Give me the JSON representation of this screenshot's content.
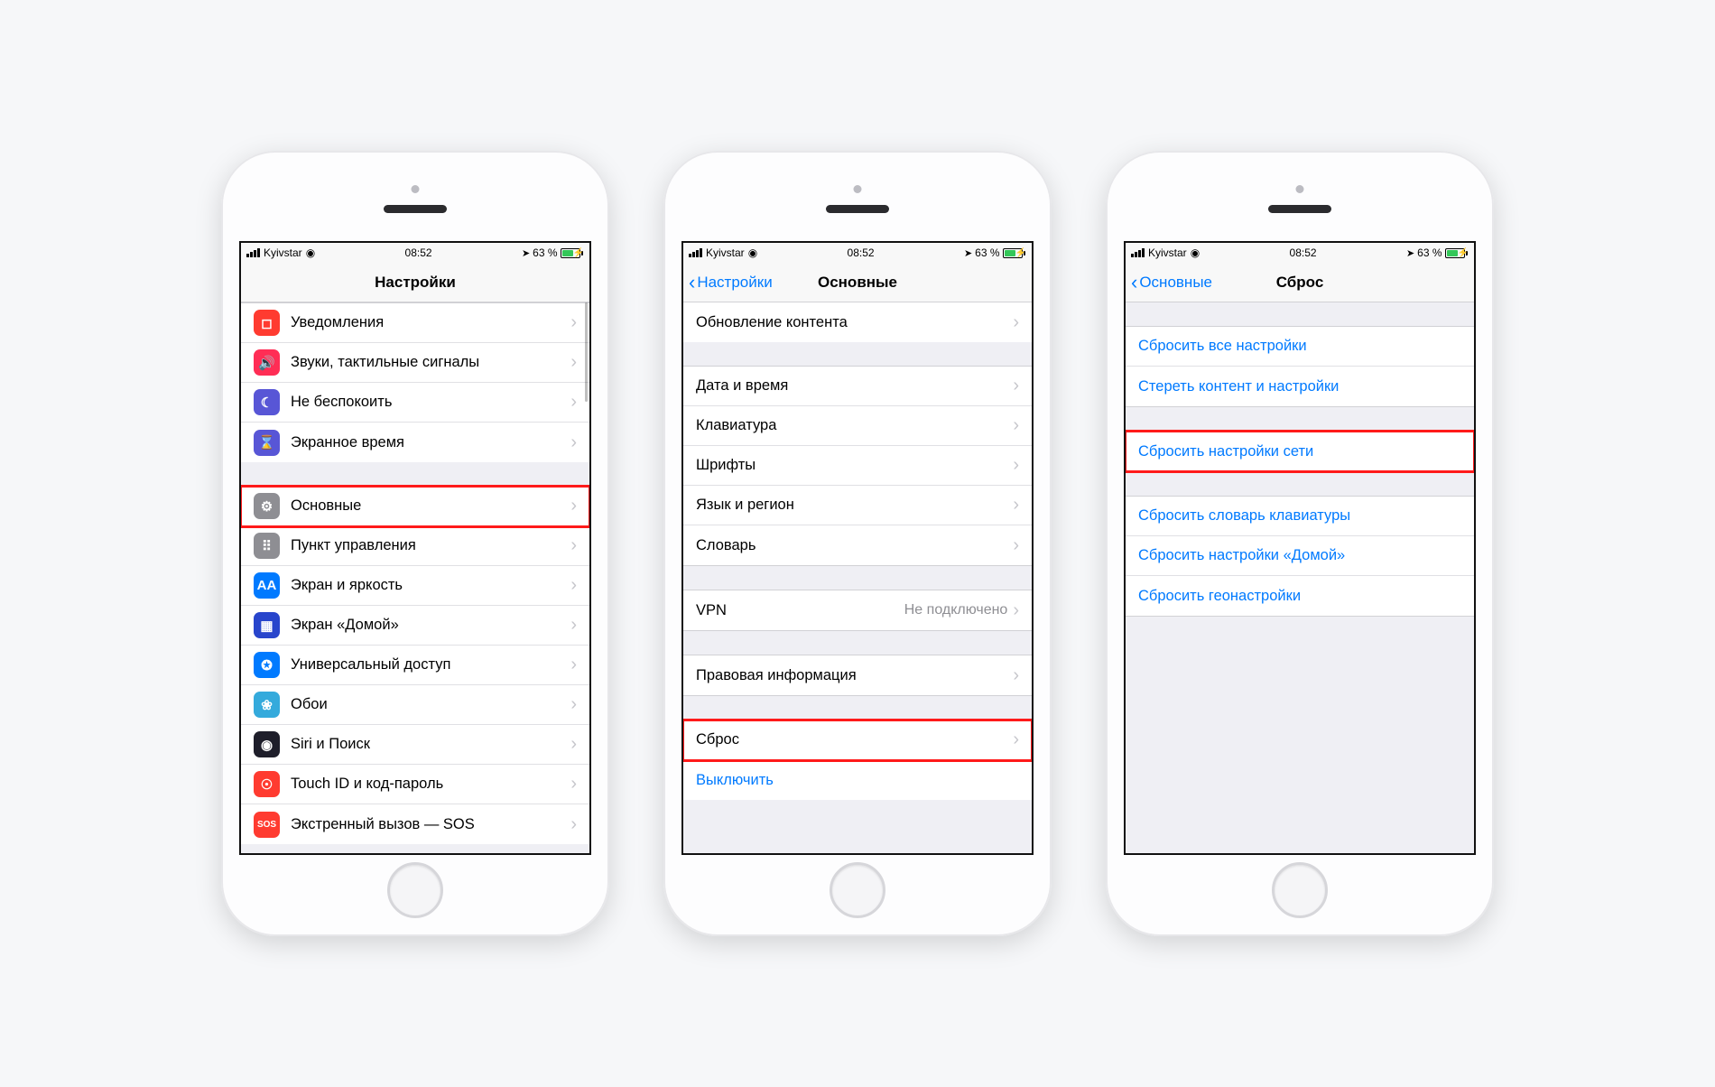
{
  "status": {
    "carrier": "Kyivstar",
    "time": "08:52",
    "battery_pct": "63 %"
  },
  "phone1": {
    "title": "Настройки",
    "group1": [
      {
        "iconBg": "#ff3b30",
        "glyph": "◻",
        "name": "notifications",
        "label": "Уведомления"
      },
      {
        "iconBg": "#ff2d55",
        "glyph": "🔊",
        "name": "sounds",
        "label": "Звуки, тактильные сигналы"
      },
      {
        "iconBg": "#5856d6",
        "glyph": "☾",
        "name": "dnd",
        "label": "Не беспокоить"
      },
      {
        "iconBg": "#5856d6",
        "glyph": "⌛",
        "name": "screentime",
        "label": "Экранное время"
      }
    ],
    "group2": [
      {
        "iconBg": "#8e8e93",
        "glyph": "⚙",
        "name": "general",
        "label": "Основные",
        "hl": true
      },
      {
        "iconBg": "#8e8e93",
        "glyph": "⠿",
        "name": "control-center",
        "label": "Пункт управления"
      },
      {
        "iconBg": "#007aff",
        "glyph": "AA",
        "name": "display",
        "label": "Экран и яркость"
      },
      {
        "iconBg": "#2845cc",
        "glyph": "▦",
        "name": "home",
        "label": "Экран «Домой»"
      },
      {
        "iconBg": "#007aff",
        "glyph": "✪",
        "name": "accessibility",
        "label": "Универсальный доступ"
      },
      {
        "iconBg": "#34aadc",
        "glyph": "❀",
        "name": "wallpaper",
        "label": "Обои"
      },
      {
        "iconBg": "#1e1e2a",
        "glyph": "◉",
        "name": "siri",
        "label": "Siri и Поиск"
      },
      {
        "iconBg": "#ff3b30",
        "glyph": "☉",
        "name": "touchid",
        "label": "Touch ID и код-пароль"
      },
      {
        "iconBg": "#ff3b30",
        "glyph": "SOS",
        "name": "sos",
        "label": "Экстренный вызов — SOS"
      }
    ]
  },
  "phone2": {
    "back": "Настройки",
    "title": "Основные",
    "groupA": [
      {
        "name": "content-refresh",
        "label": "Обновление контента"
      }
    ],
    "groupB": [
      {
        "name": "date-time",
        "label": "Дата и время"
      },
      {
        "name": "keyboard",
        "label": "Клавиатура"
      },
      {
        "name": "fonts",
        "label": "Шрифты"
      },
      {
        "name": "language",
        "label": "Язык и регион"
      },
      {
        "name": "dictionary",
        "label": "Словарь"
      }
    ],
    "groupC": [
      {
        "name": "vpn",
        "label": "VPN",
        "value": "Не подключено"
      }
    ],
    "groupD": [
      {
        "name": "legal",
        "label": "Правовая информация"
      }
    ],
    "groupE": [
      {
        "name": "reset",
        "label": "Сброс",
        "hl": true
      },
      {
        "name": "shutdown",
        "label": "Выключить",
        "link": true,
        "nochev": true
      }
    ]
  },
  "phone3": {
    "back": "Основные",
    "title": "Сброс",
    "groupA": [
      {
        "name": "reset-all",
        "label": "Сбросить все настройки"
      },
      {
        "name": "erase-all",
        "label": "Стереть контент и настройки"
      }
    ],
    "groupB": [
      {
        "name": "reset-network",
        "label": "Сбросить настройки сети",
        "hl": true
      }
    ],
    "groupC": [
      {
        "name": "reset-keyboard",
        "label": "Сбросить словарь клавиатуры"
      },
      {
        "name": "reset-home",
        "label": "Сбросить настройки «Домой»"
      },
      {
        "name": "reset-location",
        "label": "Сбросить геонастройки"
      }
    ]
  }
}
